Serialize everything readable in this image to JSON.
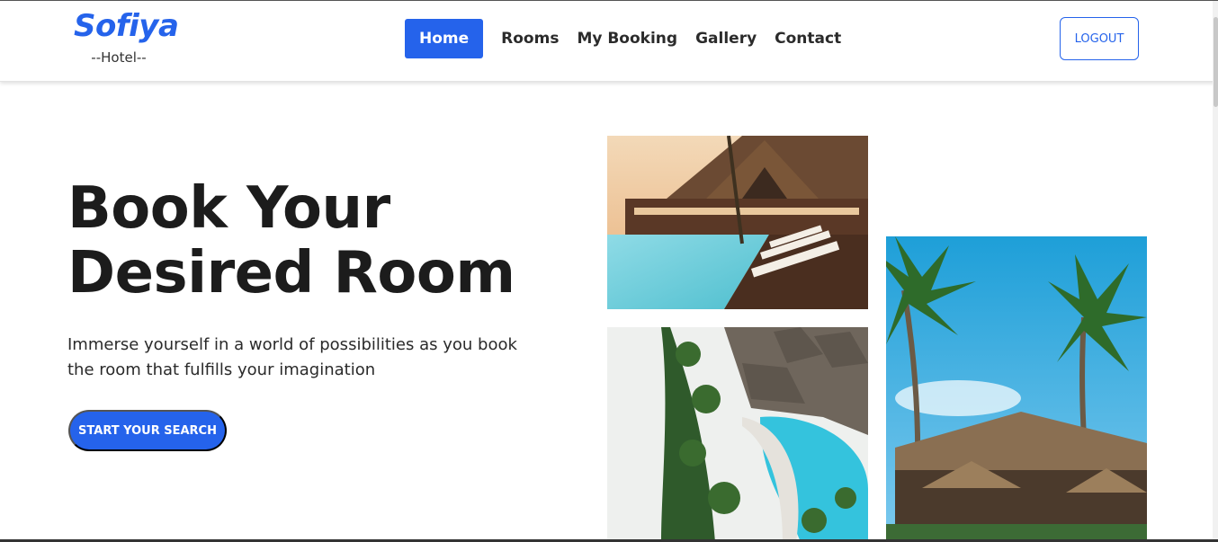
{
  "brand": {
    "name": "Sofiya",
    "subtitle": "--Hotel--",
    "color": "#2563eb"
  },
  "nav": {
    "items": [
      {
        "label": "Home",
        "active": true
      },
      {
        "label": "Rooms",
        "active": false
      },
      {
        "label": "My Booking",
        "active": false
      },
      {
        "label": "Gallery",
        "active": false
      },
      {
        "label": "Contact",
        "active": false
      }
    ],
    "logout_label": "LOGOUT"
  },
  "hero": {
    "title_line1": "Book Your",
    "title_line2": "Desired Room",
    "description": "Immerse yourself in a world of possibilities as you book the room that fulfills your imagination",
    "cta_label": "START YOUR SEARCH"
  },
  "gallery": {
    "images": [
      {
        "subject": "resort-pool-deck-photo"
      },
      {
        "subject": "aerial-resort-pool-photo"
      },
      {
        "subject": "palm-trees-huts-photo"
      }
    ]
  },
  "colors": {
    "accent": "#2563eb",
    "text": "#1c1c1c"
  }
}
